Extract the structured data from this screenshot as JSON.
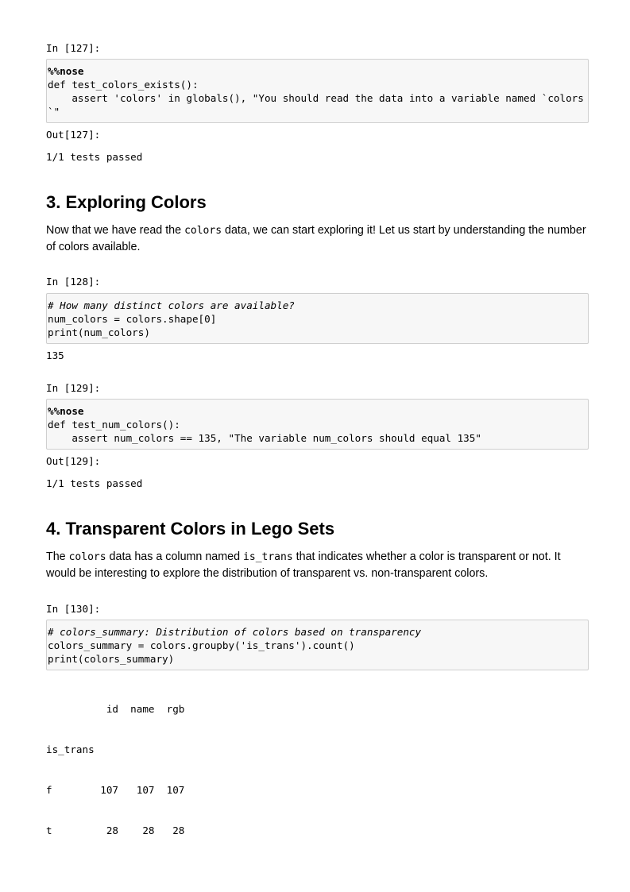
{
  "cells": {
    "c127": {
      "prompt_in": "In [127]:",
      "lines": [
        "%%nose",
        "def test_colors_exists():",
        "    assert 'colors' in globals(), \"You should read the data into a variable named `colors`\""
      ],
      "prompt_out": "Out[127]:",
      "output": "1/1 tests passed"
    },
    "section3": {
      "title": "3. Exploring Colors",
      "para_before": "Now that we have read the ",
      "para_code": "colors",
      "para_after": " data, we can start exploring it! Let us start by understanding the number of colors available."
    },
    "c128": {
      "prompt_in": "In [128]:",
      "lines": [
        "# How many distinct colors are available?",
        "num_colors = colors.shape[0]",
        "print(num_colors)"
      ],
      "output": "135"
    },
    "c129": {
      "prompt_in": "In [129]:",
      "lines": [
        "%%nose",
        "def test_num_colors():",
        "    assert num_colors == 135, \"The variable num_colors should equal 135\""
      ],
      "prompt_out": "Out[129]:",
      "output": "1/1 tests passed"
    },
    "section4": {
      "title": "4. Transparent Colors in Lego Sets",
      "para_1": "The ",
      "para_code_1": "colors",
      "para_2": " data has a column named ",
      "para_code_2": "is_trans",
      "para_3": " that indicates whether a color is transparent or not. It would be interesting to explore the distribution of transparent vs. non-transparent colors."
    },
    "c130": {
      "prompt_in": "In [130]:",
      "lines": [
        "# colors_summary: Distribution of colors based on transparency",
        "colors_summary = colors.groupby('is_trans').count()",
        "print(colors_summary)"
      ],
      "output_lines": [
        "          id  name  rgb",
        "is_trans",
        "f        107   107  107",
        "t         28    28   28"
      ]
    }
  }
}
